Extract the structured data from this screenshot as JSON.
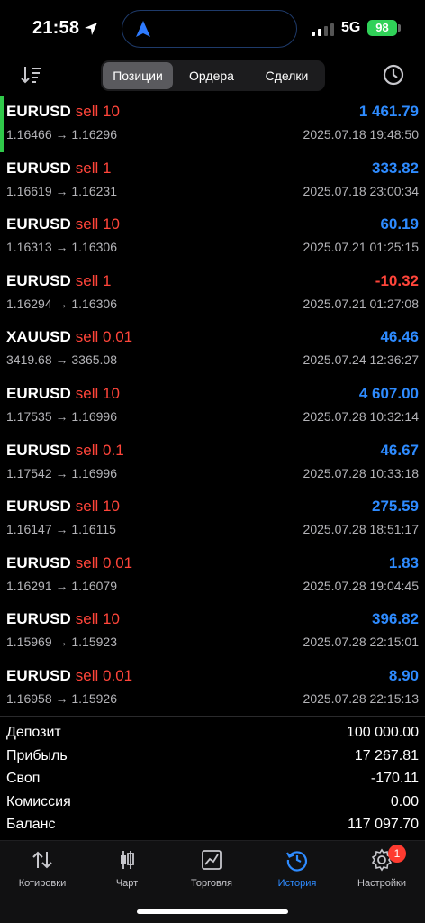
{
  "status": {
    "time": "21:58",
    "network": "5G",
    "battery": "98"
  },
  "header": {
    "tabs": [
      {
        "label": "Позиции",
        "active": true
      },
      {
        "label": "Ордера",
        "active": false
      },
      {
        "label": "Сделки",
        "active": false
      }
    ]
  },
  "trades": [
    {
      "symbol": "EURUSD",
      "direction": "sell 10",
      "prices": "1.16466 → 1.16296",
      "profit": "1 461.79",
      "date": "2025.07.18 19:48:50"
    },
    {
      "symbol": "EURUSD",
      "direction": "sell 1",
      "prices": "1.16619 → 1.16231",
      "profit": "333.82",
      "date": "2025.07.18 23:00:34"
    },
    {
      "symbol": "EURUSD",
      "direction": "sell 10",
      "prices": "1.16313 → 1.16306",
      "profit": "60.19",
      "date": "2025.07.21 01:25:15"
    },
    {
      "symbol": "EURUSD",
      "direction": "sell 1",
      "prices": "1.16294 → 1.16306",
      "profit": "-10.32",
      "date": "2025.07.21 01:27:08"
    },
    {
      "symbol": "XAUUSD",
      "direction": "sell 0.01",
      "prices": "3419.68 → 3365.08",
      "profit": "46.46",
      "date": "2025.07.24 12:36:27"
    },
    {
      "symbol": "EURUSD",
      "direction": "sell 10",
      "prices": "1.17535 → 1.16996",
      "profit": "4 607.00",
      "date": "2025.07.28 10:32:14"
    },
    {
      "symbol": "EURUSD",
      "direction": "sell 0.1",
      "prices": "1.17542 → 1.16996",
      "profit": "46.67",
      "date": "2025.07.28 10:33:18"
    },
    {
      "symbol": "EURUSD",
      "direction": "sell 10",
      "prices": "1.16147 → 1.16115",
      "profit": "275.59",
      "date": "2025.07.28 18:51:17"
    },
    {
      "symbol": "EURUSD",
      "direction": "sell 0.01",
      "prices": "1.16291 → 1.16079",
      "profit": "1.83",
      "date": "2025.07.28 19:04:45"
    },
    {
      "symbol": "EURUSD",
      "direction": "sell 10",
      "prices": "1.15969 → 1.15923",
      "profit": "396.82",
      "date": "2025.07.28 22:15:01"
    },
    {
      "symbol": "EURUSD",
      "direction": "sell 0.01",
      "prices": "1.16958 → 1.15926",
      "profit": "8.90",
      "date": "2025.07.28 22:15:13"
    }
  ],
  "summary": [
    {
      "label": "Депозит",
      "value": "100 000.00"
    },
    {
      "label": "Прибыль",
      "value": "17 267.81"
    },
    {
      "label": "Своп",
      "value": "-170.11"
    },
    {
      "label": "Комиссия",
      "value": "0.00"
    },
    {
      "label": "Баланс",
      "value": "117 097.70"
    }
  ],
  "tabbar": {
    "items": [
      {
        "label": "Котировки",
        "icon": "arrows-updown-icon"
      },
      {
        "label": "Чарт",
        "icon": "candlestick-icon"
      },
      {
        "label": "Торговля",
        "icon": "trade-chart-icon"
      },
      {
        "label": "История",
        "icon": "history-clock-icon",
        "active": true
      },
      {
        "label": "Настройки",
        "icon": "gear-icon",
        "badge": "1"
      }
    ]
  },
  "colors": {
    "positive": "#2e8bff",
    "negative": "#ff453a",
    "accent_green": "#30c94a"
  }
}
